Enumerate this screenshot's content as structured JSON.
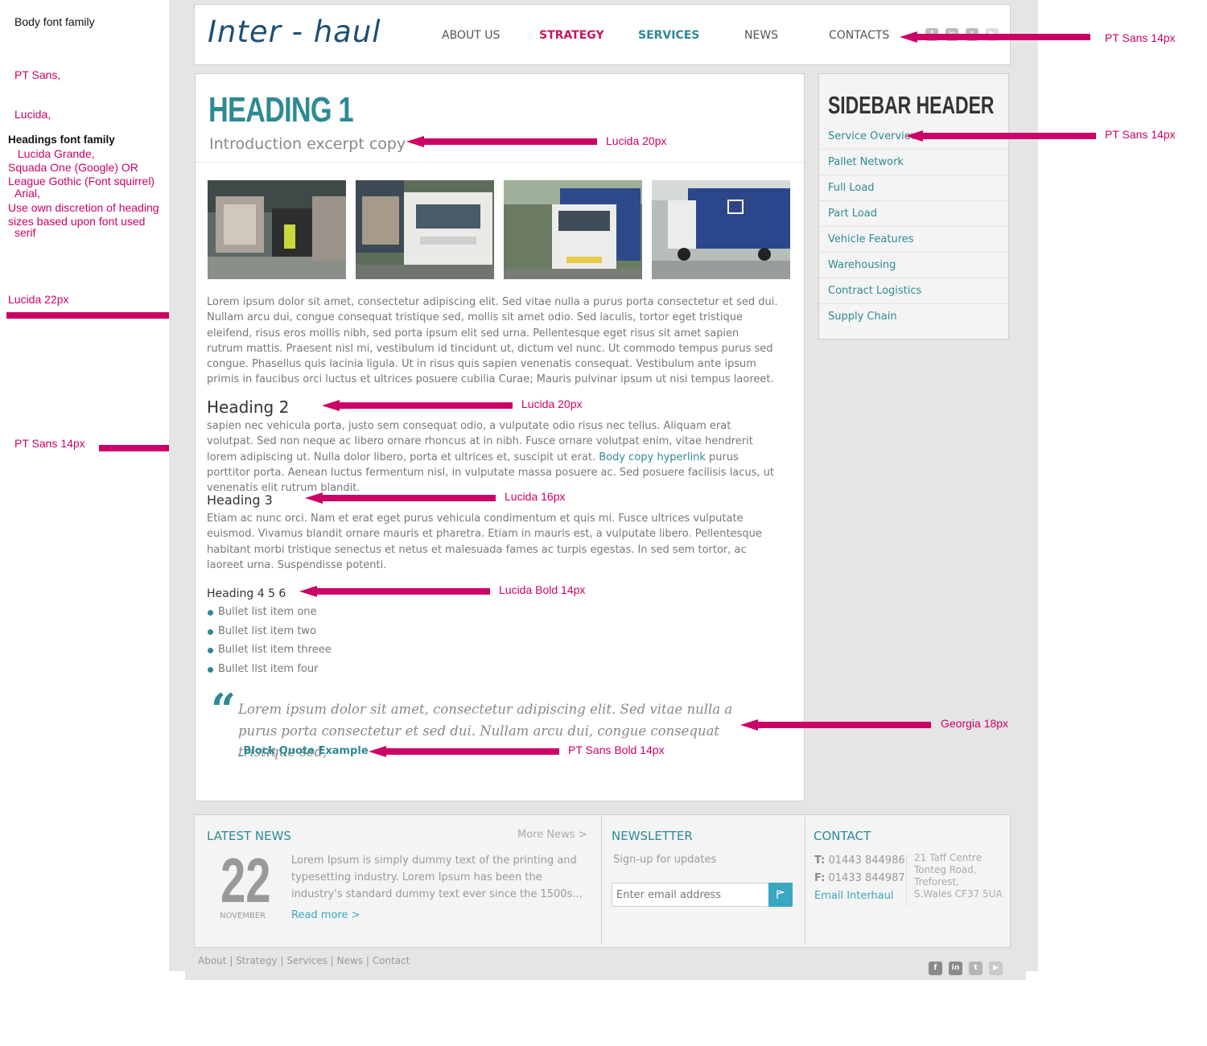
{
  "annotations": {
    "body_font_label": "Body font family",
    "body_font_stack": [
      "PT Sans,",
      "Lucida,",
      " Lucida Grande,",
      "Arial,",
      "serif"
    ],
    "headings_font_label": "Headings font family",
    "headings_font_stack": [
      "Squada One (Google) OR",
      "League Gothic (Font squirrel)"
    ],
    "headings_note": [
      "Use own discretion of heading",
      "sizes based upon font used"
    ],
    "lucida22": "Lucida 22px",
    "ptsans14_left": "PT Sans 14px",
    "nav_font": "PT Sans 14px",
    "sidebar_font": "PT Sans 14px",
    "intro_font": "Lucida 20px",
    "h2_font": "Lucida 20px",
    "h3_font": "Lucida 16px",
    "h4_font": "Lucida Bold 14px",
    "quote_font": "Georgia 18px",
    "cite_font": "PT Sans Bold 14px"
  },
  "header": {
    "logo": "Inter - haul",
    "nav": [
      "ABOUT US",
      "STRATEGY",
      "SERVICES",
      "NEWS",
      "CONTACTS"
    ],
    "social_icons": [
      "facebook-icon",
      "linkedin-icon",
      "twitter-icon",
      "youtube-icon"
    ]
  },
  "main": {
    "h1": "HEADING 1",
    "intro": "Introduction excerpt copy",
    "photos": [
      "forklift-photo",
      "truck-loading-photo",
      "truck-front-photo",
      "truck-side-photo"
    ],
    "para1": "Lorem ipsum dolor sit amet, consectetur adipiscing elit. Sed vitae nulla a purus porta consectetur et sed dui. Nullam arcu dui, congue consequat tristique sed, mollis sit amet odio. Sed iaculis, tortor eget tristique eleifend, risus eros mollis nibh, sed porta ipsum elit sed urna. Pellentesque eget risus sit amet sapien rutrum mattis. Praesent nisl mi, vestibulum id tincidunt ut, dictum vel nunc. Ut commodo tempus purus sed congue. Phasellus quis lacinia ligula. Ut in risus quis sapien venenatis consequat. Vestibulum ante ipsum primis in faucibus orci luctus et ultrices posuere cubilia Curae; Mauris pulvinar ipsum ut nisi tempus laoreet.",
    "h2": "Heading 2",
    "para2_a": "sapien nec vehicula porta, justo sem consequat odio, a vulputate odio risus nec tellus. Aliquam erat volutpat. Sed non neque ac libero ornare rhoncus at in nibh. Fusce ornare volutpat enim, vitae hendrerit lorem adipiscing ut. Nulla dolor libero, porta et ultrices et, suscipit ut erat.",
    "para2_link": "Body copy hyperlink",
    "para2_b": "purus porttitor porta. Aenean luctus fermentum nisl, in vulputate massa posuere ac. Sed posuere facilisis lacus, ut venenatis elit rutrum blandit.",
    "h3": "Heading 3",
    "para3": "Etiam ac nunc orci. Nam et erat eget purus vehicula condimentum et quis mi. Fusce ultrices vulputate euismod. Vivamus blandit ornare mauris et pharetra. Etiam in mauris est, a vulputate libero. Pellentesque habitant morbi tristique senectus et netus et malesuada fames ac turpis egestas. In sed sem tortor, ac laoreet urna. Suspendisse potenti.",
    "h4": "Heading 4 5 6",
    "bullets": [
      "Bullet list item one",
      "Bullet list item two",
      "Bullet list item threee",
      "Bullet list item four"
    ],
    "quote_mark": "“",
    "quote": "Lorem ipsum dolor sit amet, consectetur adipiscing elit. Sed vitae nulla a purus porta consectetur et sed dui. Nullam arcu dui, congue consequat tristique sed,",
    "quote_cite": "_Block Quote Example"
  },
  "sidebar": {
    "header": "SIDEBAR HEADER",
    "items": [
      "Service Overview",
      "Pallet Network",
      "Full Load",
      "Part Load",
      "Vehicle Features",
      "Warehousing",
      "Contract Logistics",
      "Supply Chain"
    ]
  },
  "footer": {
    "news": {
      "title": "LATEST NEWS",
      "more": "More News >",
      "day": "22",
      "month": "NOVEMBER",
      "body": "Lorem Ipsum is simply dummy text of the printing and typesetting industry. Lorem Ipsum has been the industry's standard dummy text ever since the 1500s...",
      "read_more": "Read more >"
    },
    "newsletter": {
      "title": "NEWSLETTER",
      "subtitle": "Sign-up for updates",
      "placeholder": "Enter email address"
    },
    "contact": {
      "title": "CONTACT",
      "tel_label": "T:",
      "tel": "01443 844986",
      "fax_label": "F:",
      "fax": "01433 844987",
      "email_link": "Email Interhaul",
      "address": [
        "21 Taff Centre",
        "Tonteg Road,",
        "Treforest,",
        "S.Wales CF37 5UA"
      ]
    },
    "bottom_nav": [
      "About",
      "Strategy",
      "Services",
      "News",
      "Contact"
    ],
    "separator": "|",
    "bottom_social": [
      "facebook-icon",
      "linkedin-icon",
      "twitter-icon",
      "youtube-icon"
    ]
  },
  "colors": {
    "teal": "#2d8a95",
    "magenta": "#c8155f",
    "annotation_pink": "#cc0066",
    "navy_logo": "#1c4f77",
    "button_blue": "#3aa7c1"
  }
}
